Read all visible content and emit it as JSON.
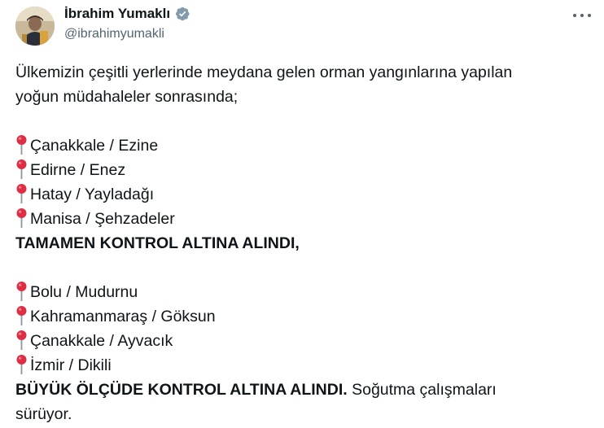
{
  "author": {
    "name": "İbrahim Yumaklı",
    "handle": "@ibrahimyumakli",
    "verified": true,
    "verified_icon": "verified-badge-icon",
    "badge_color": "#829aab"
  },
  "more_icon": "more-horizontal-icon",
  "pin_icon": "round-pushpin-icon",
  "tweet": {
    "intro_1": "Ülkemizin çeşitli yerlerinde meydana gelen orman yangınlarına yapılan",
    "intro_2": "yoğun müdahaleler sonrasında;",
    "group1": [
      "Çanakkale / Ezine",
      "Edirne / Enez",
      "Hatay / Yayladağı",
      "Manisa / Şehzadeler"
    ],
    "group1_status": "TAMAMEN KONTROL ALTINA ALINDI,",
    "group2": [
      "Bolu / Mudurnu",
      "Kahramanmaraş / Göksun",
      "Çanakkale / Ayvacık",
      "İzmir / Dikili"
    ],
    "group2_status_bold": "BÜYÜK ÖLÇÜDE KONTROL ALTINA ALINDI.",
    "group2_status_rest": " Soğutma çalışmaları",
    "final_line": "sürüyor."
  }
}
